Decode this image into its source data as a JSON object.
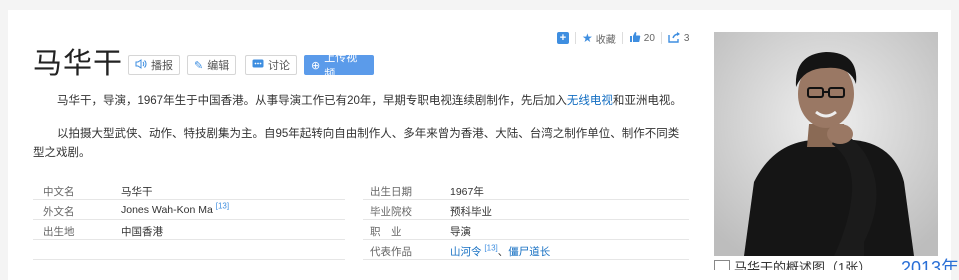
{
  "toolbar": {
    "favorite_label": "收藏",
    "like_count": "20",
    "share_count": "3"
  },
  "title": "马华干",
  "buttons": {
    "play": "播报",
    "edit": "编辑",
    "discuss": "讨论",
    "upload": "上传视频"
  },
  "summary": {
    "p1_before": "马华干，导演，1967年生于中国香港。从事导演工作已有20年，早期专职电视连续剧制作，先后加入",
    "p1_link": "无线电视",
    "p1_after": "和亚洲电视。",
    "p2": "以拍摄大型武侠、动作、特技剧集为主。自95年起转向自由制作人、多年来曾为香港、大陆、台湾之制作单位、制作不同类型之戏剧。"
  },
  "info_left": [
    {
      "name": "中文名",
      "value": "马华干",
      "ref": ""
    },
    {
      "name": "外文名",
      "value": "Jones Wah-Kon Ma",
      "ref": "[13]"
    },
    {
      "name": "出生地",
      "value": "中国香港",
      "ref": ""
    }
  ],
  "info_right": [
    {
      "name": "出生日期",
      "value": "1967年"
    },
    {
      "name": "毕业院校",
      "value": "预科毕业"
    },
    {
      "name": "职　业",
      "value": "导演"
    },
    {
      "name": "代表作品",
      "link1": "山河令",
      "ref": "[13]",
      "sep": "、",
      "link2": "僵尸道长"
    }
  ],
  "caption": {
    "text": "马华干的概述图（1张）",
    "year": "2013年"
  },
  "colors": {
    "accent": "#3e8ee0",
    "link": "#136ec2",
    "primary_button": "#5b9bea"
  }
}
